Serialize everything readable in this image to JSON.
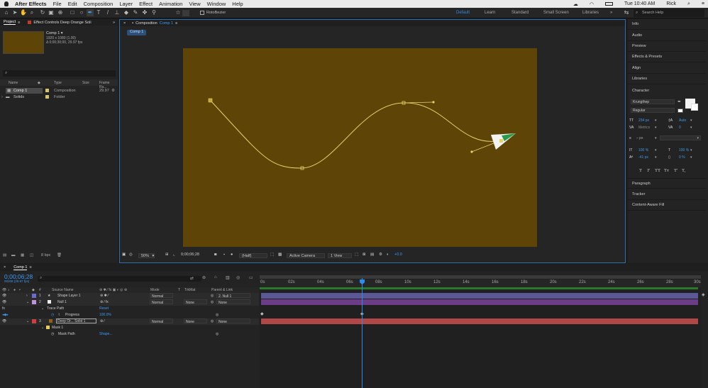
{
  "menubar": {
    "apple": "",
    "app": "After Effects",
    "items": [
      "File",
      "Edit",
      "Composition",
      "Layer",
      "Effect",
      "Animation",
      "View",
      "Window",
      "Help"
    ],
    "clock": "Tue 10:40 AM",
    "user": "Rick"
  },
  "toolbar": {
    "roto": "RotoBezier",
    "workspaces": [
      "Default",
      "Learn",
      "Standard",
      "Small Screen",
      "Libraries"
    ],
    "search_placeholder": "Search Help"
  },
  "project": {
    "tab1": "Project",
    "tab2": "Effect Controls Deep Orange Soli",
    "comp_name": "Comp 1 ▾",
    "comp_info1": "1920 x 1080 (1.00)",
    "comp_info2": "Δ 0;00;30;00, 29.97 fps",
    "cols": {
      "name": "Name",
      "type": "Type",
      "size": "Size",
      "fps": "Frame Ra..."
    },
    "items": [
      {
        "name": "Comp 1",
        "type": "Composition",
        "fps": "29.97"
      },
      {
        "name": "Solids",
        "type": "Folder",
        "fps": ""
      }
    ],
    "bpc": "8 bpc"
  },
  "comp": {
    "tab": "Composition",
    "tab_name": "Comp 1",
    "breadcrumb": "Comp 1",
    "zoom": "50%",
    "time": "0;00;06;28",
    "res": "(Half)",
    "camera": "Active Camera",
    "view": "1 View",
    "exposure": "+0.0"
  },
  "right": {
    "panels": [
      "Info",
      "Audio",
      "Preview",
      "Effects & Presets",
      "Align",
      "Libraries"
    ],
    "character": "Character",
    "font": "Krungthep",
    "style": "Regular",
    "size": "234 px",
    "leading": "Auto",
    "tracking_label": "Metrics",
    "tracking": "0",
    "stroke": "– px",
    "vscale": "100 %",
    "hscale": "100 %",
    "baseline": "-41 px",
    "tsume": "0 %",
    "type_btns": [
      "T",
      "T",
      "TT",
      "Tт",
      "T'",
      "T,"
    ],
    "lower": [
      "Paragraph",
      "Tracker",
      "Content-Aware Fill"
    ]
  },
  "timeline": {
    "tab": "Comp 1",
    "time": "0;00;06;28",
    "frames": "00208 (29.97 fps)",
    "hdr": {
      "num": "#",
      "src": "Source Name",
      "mode": "Mode",
      "t": "T",
      "trk": "TrkMat",
      "parent": "Parent & Link"
    },
    "layers": [
      {
        "n": "1",
        "name": "Shape Layer 1",
        "mode": "Normal",
        "trk": "",
        "parent": "2. Null 1"
      },
      {
        "n": "2",
        "name": "Null 1",
        "mode": "Normal",
        "trk": "None",
        "parent": "None"
      },
      {
        "n": "3",
        "name": "Deep Or... Solid 1",
        "mode": "Normal",
        "trk": "None",
        "parent": "None"
      }
    ],
    "fx": "fx",
    "trace": "Trace Path",
    "reset": "Reset",
    "progress": "Progress",
    "progress_val": "100.0%",
    "mask": "Mask 1",
    "maskpath": "Mask Path",
    "shape": "Shape...",
    "ruler": [
      "0s",
      "02s",
      "04s",
      "06s",
      "08s",
      "10s",
      "12s",
      "14s",
      "16s",
      "18s",
      "20s",
      "22s",
      "24s",
      "26s",
      "28s",
      "30s"
    ]
  },
  "colors": {
    "accent": "#2d8ceb",
    "comp_bg": "#5e4406",
    "path": "#e7d26a",
    "shape_bar": "#5b5897",
    "null_bar": "#6b3d86",
    "solid_bar": "#b04848"
  }
}
